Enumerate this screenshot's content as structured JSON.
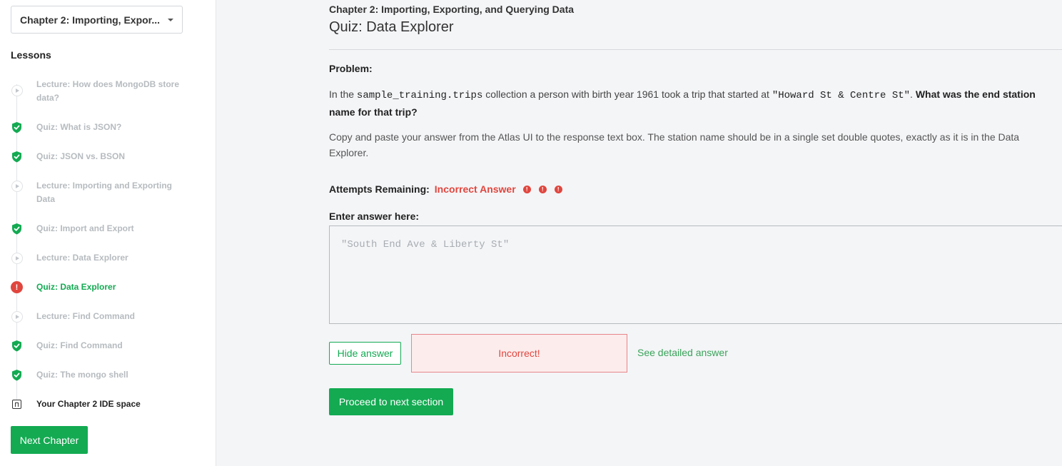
{
  "sidebar": {
    "chapter_select": "Chapter 2: Importing, Expor...",
    "lessons_heading": "Lessons",
    "items": [
      {
        "label": "Lecture: How does MongoDB store data?",
        "status": "video"
      },
      {
        "label": "Quiz: What is JSON?",
        "status": "complete"
      },
      {
        "label": "Quiz: JSON vs. BSON",
        "status": "complete"
      },
      {
        "label": "Lecture: Importing and Exporting Data",
        "status": "video"
      },
      {
        "label": "Quiz: Import and Export",
        "status": "complete"
      },
      {
        "label": "Lecture: Data Explorer",
        "status": "video"
      },
      {
        "label": "Quiz: Data Explorer",
        "status": "error"
      },
      {
        "label": "Lecture: Find Command",
        "status": "video"
      },
      {
        "label": "Quiz: Find Command",
        "status": "complete"
      },
      {
        "label": "Quiz: The mongo shell",
        "status": "complete"
      },
      {
        "label": "Your Chapter 2 IDE space",
        "status": "bookmark"
      }
    ],
    "next_chapter": "Next Chapter"
  },
  "main": {
    "chapter_title": "Chapter 2: Importing, Exporting, and Querying Data",
    "page_title": "Quiz: Data Explorer",
    "problem_label": "Problem:",
    "question": {
      "part1": "In the ",
      "code1": "sample_training.trips",
      "part2": " collection a person with birth year 1961 took a trip that started at ",
      "code2": "\"Howard St & Centre St\"",
      "part3": ". ",
      "bold": "What was the end station name for that trip?"
    },
    "instructions": "Copy and paste your answer from the Atlas UI to the response text box. The station name should be in a single set double quotes, exactly as it is in the Data Explorer.",
    "attempts_label": "Attempts Remaining:",
    "attempts_status": "Incorrect Answer",
    "attempts_icons": [
      "error-icon",
      "error-icon",
      "error-icon"
    ],
    "answer_label": "Enter answer here:",
    "answer_value": "\"South End Ave & Liberty St\"",
    "hide_answer": "Hide answer",
    "result": "Incorrect!",
    "detailed_answer": "See detailed answer",
    "proceed": "Proceed to next section"
  },
  "colors": {
    "brand_green": "#13aa52",
    "error_red": "#e0463e",
    "background": "#f4f5f7"
  }
}
